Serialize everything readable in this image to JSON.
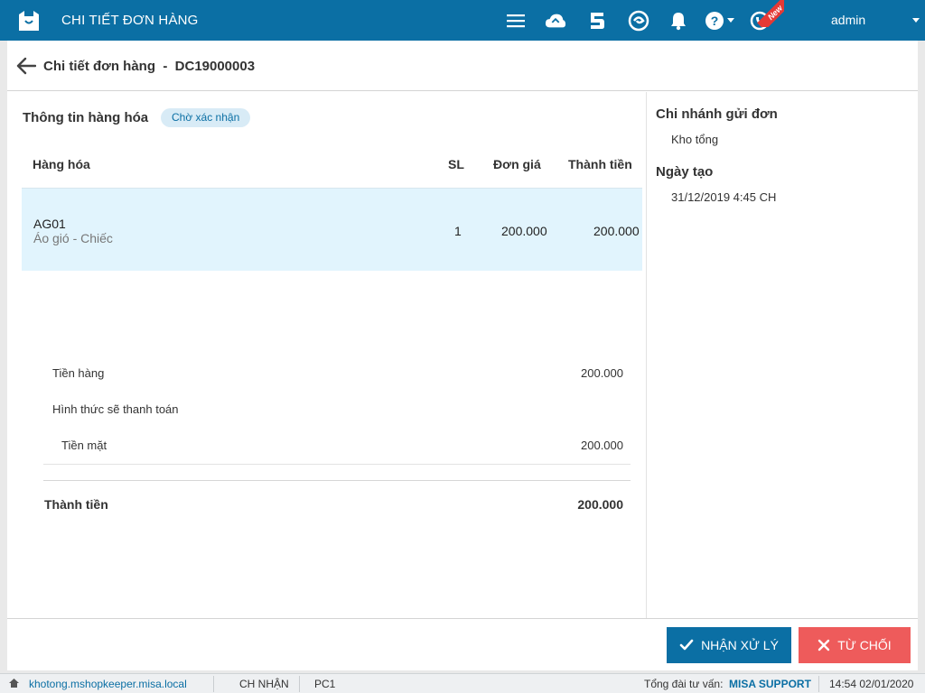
{
  "app": {
    "title": "CHI TIẾT ĐƠN HÀNG",
    "user": "admin",
    "new_badge": "New"
  },
  "page": {
    "title": "Chi tiết đơn hàng  -  DC19000003"
  },
  "goods": {
    "section_title": "Thông tin hàng hóa",
    "status": "Chờ xác nhận",
    "columns": {
      "item": "Hàng hóa",
      "qty": "SL",
      "price": "Đơn giá",
      "total": "Thành tiền"
    },
    "rows": [
      {
        "code": "AG01",
        "desc": "Áo gió - Chiếc",
        "qty": "1",
        "price": "200.000",
        "total": "200.000"
      }
    ]
  },
  "summary": {
    "goods_label": "Tiền hàng",
    "goods_value": "200.000",
    "payment_label": "Hình thức sẽ thanh toán",
    "cash_label": "Tiền mặt",
    "cash_value": "200.000",
    "total_label": "Thành tiền",
    "total_value": "200.000"
  },
  "details": {
    "branch_label": "Chi nhánh gửi đơn",
    "branch_value": "Kho tổng",
    "date_label": "Ngày tạo",
    "date_value": "31/12/2019 4:45 CH"
  },
  "actions": {
    "accept": "NHẬN XỬ LÝ",
    "reject": "TỪ CHỐI"
  },
  "statusbar": {
    "host": "khotong.mshopkeeper.misa.local",
    "branch": "CH NHẬN",
    "pc": "PC1",
    "hotline_label": "Tổng đài tư vấn:",
    "hotline_value": "MISA SUPPORT",
    "datetime": "14:54 02/01/2020"
  },
  "colors": {
    "primary": "#0b6fa4",
    "danger": "#ee5b5b",
    "row_highlight": "#e1f4fd"
  }
}
